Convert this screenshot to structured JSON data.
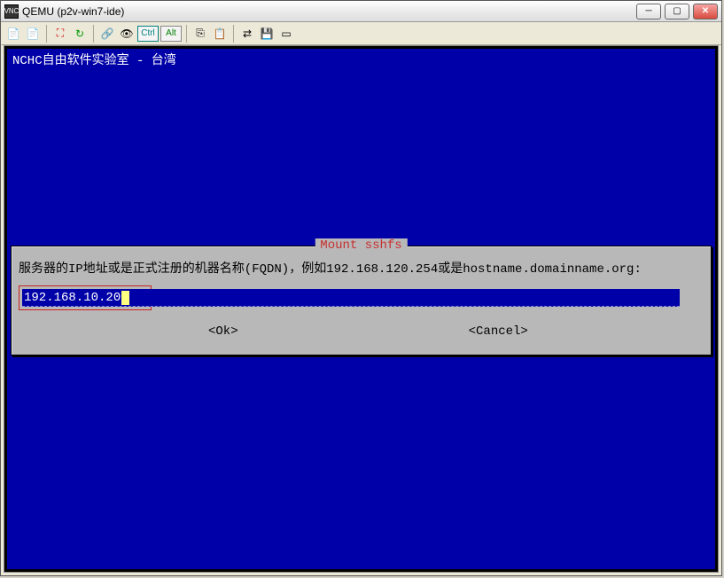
{
  "window": {
    "title": "QEMU (p2v-win7-ide)"
  },
  "toolbar": {
    "icons": {
      "doc1": "📄",
      "doc2": "📄",
      "fullscreen": "⛶",
      "refresh": "↻",
      "link": "🔗",
      "eye": "👁",
      "ctrl": "Ctrl",
      "alt": "Alt",
      "copy": "⎘",
      "paste": "📋",
      "transfer": "⇄",
      "save": "💾",
      "window": "▭"
    }
  },
  "console": {
    "header": "NCHC自由软件实验室 - 台湾"
  },
  "dialog": {
    "title": "Mount sshfs",
    "prompt": "服务器的IP地址或是正式注册的机器名称(FQDN)，例如192.168.120.254或是hostname.domainname.org:",
    "input_value": "192.168.10.20",
    "ok_label": "<Ok>",
    "cancel_label": "<Cancel>"
  }
}
